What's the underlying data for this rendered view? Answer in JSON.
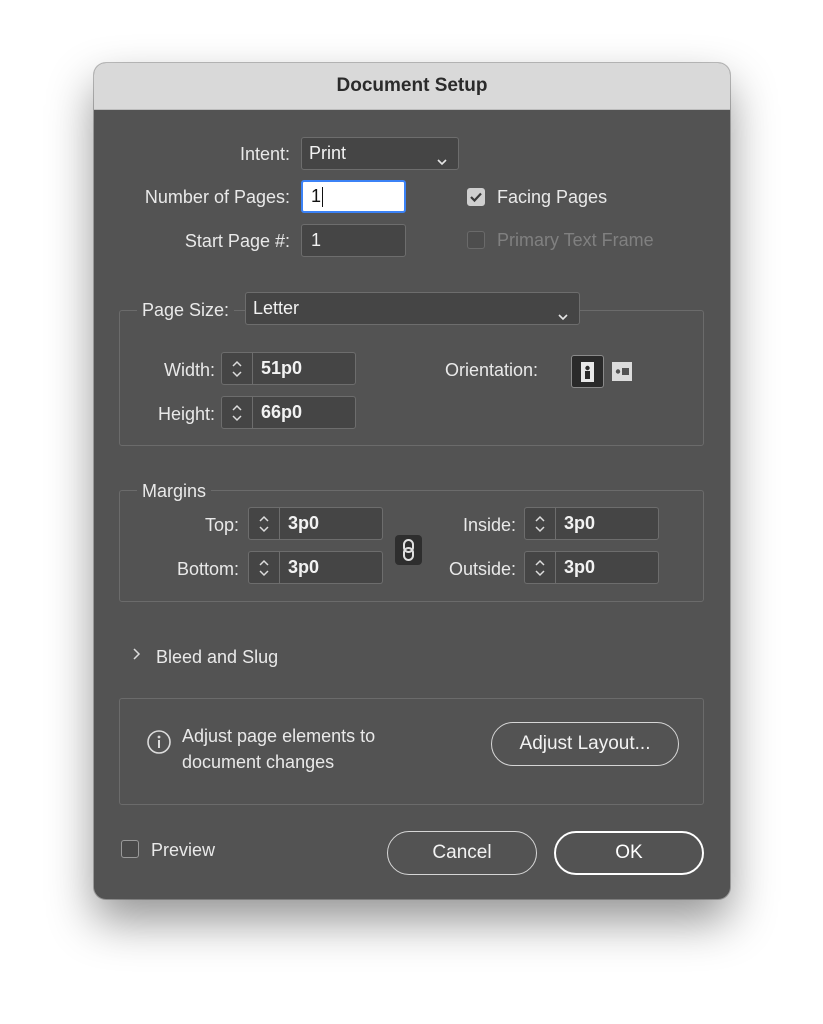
{
  "window": {
    "title": "Document Setup"
  },
  "intent": {
    "label": "Intent:",
    "value": "Print"
  },
  "pages": {
    "number_label": "Number of Pages:",
    "number_value": "1",
    "start_label": "Start Page #:",
    "start_value": "1",
    "facing_label": "Facing Pages",
    "facing_checked": true,
    "primary_text_label": "Primary Text Frame",
    "primary_text_checked": false
  },
  "page_size": {
    "label": "Page Size:",
    "value": "Letter",
    "width_label": "Width:",
    "width_value": "51p0",
    "height_label": "Height:",
    "height_value": "66p0",
    "orientation_label": "Orientation:",
    "orientation_icons": [
      "portrait-icon",
      "landscape-icon"
    ]
  },
  "margins": {
    "title": "Margins",
    "top_label": "Top:",
    "top_value": "3p0",
    "bottom_label": "Bottom:",
    "bottom_value": "3p0",
    "inside_label": "Inside:",
    "inside_value": "3p0",
    "outside_label": "Outside:",
    "outside_value": "3p0"
  },
  "bleed": {
    "label": "Bleed and Slug"
  },
  "adjust": {
    "line1": "Adjust page elements to",
    "line2": "document changes",
    "button": "Adjust Layout..."
  },
  "footer": {
    "preview_label": "Preview",
    "cancel": "Cancel",
    "ok": "OK"
  },
  "colors": {
    "dialog_bg": "#535353",
    "titlebar_bg": "#d9d9d9",
    "field_bg": "#454545",
    "focus_ring": "#3b82f6"
  }
}
